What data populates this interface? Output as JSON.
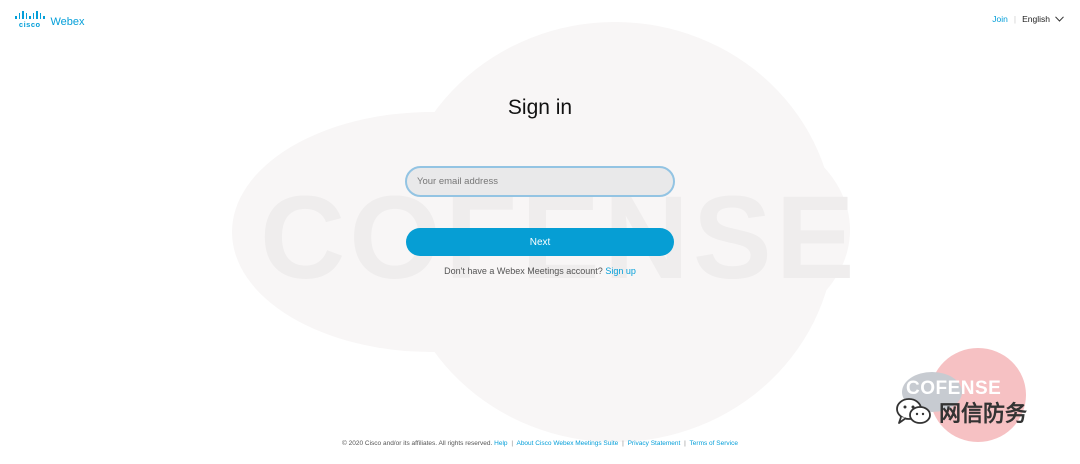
{
  "brand": {
    "company": "cisco",
    "product": "Webex",
    "accent_color": "#049fd9"
  },
  "topnav": {
    "join_label": "Join",
    "language_label": "English",
    "language_icon": "chevron-down-icon"
  },
  "signin": {
    "title": "Sign in",
    "email_placeholder": "Your email address",
    "email_value": "",
    "next_label": "Next",
    "signup_prompt": "Don't have a Webex Meetings account?",
    "signup_link": "Sign up"
  },
  "footer": {
    "copyright": "© 2020 Cisco and/or its affiliates. All rights reserved.",
    "links": [
      "Help",
      "About Cisco Webex Meetings Suite",
      "Privacy Statement",
      "Terms of Service"
    ]
  },
  "watermark": {
    "background_word": "COFENSE",
    "badge_text": "COFENSE",
    "wechat_account": "网信防务",
    "wechat_icon": "wechat-icon"
  }
}
